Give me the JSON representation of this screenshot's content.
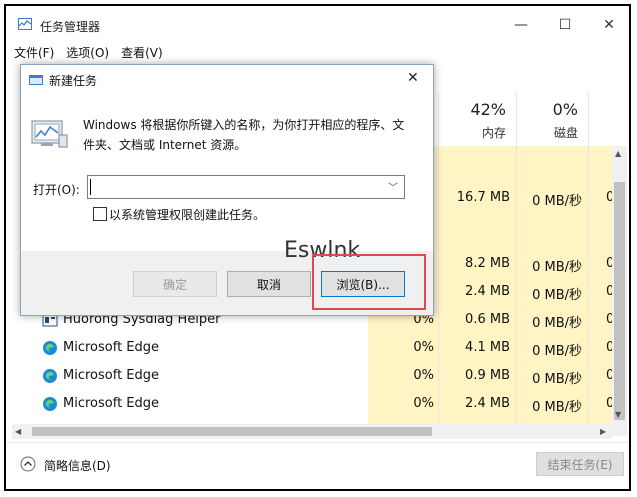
{
  "window": {
    "title": "任务管理器"
  },
  "menu": [
    "文件(F)",
    "选项(O)",
    "查看(V)"
  ],
  "columns": {
    "memory": {
      "percent": "42%",
      "label": "内存"
    },
    "disk": {
      "percent": "0%",
      "label": "磁盘"
    }
  },
  "rows": [
    {
      "name": "",
      "cpu": "",
      "mem": "16.7 MB",
      "disk": "0 MB/秒",
      "net": "0"
    },
    {
      "name": "",
      "cpu": "",
      "mem": "8.2 MB",
      "disk": "0 MB/秒",
      "net": "0"
    },
    {
      "name": "",
      "cpu": "",
      "mem": "2.4 MB",
      "disk": "0 MB/秒",
      "net": "0"
    },
    {
      "name": "Huorong Sysdiag Helper",
      "cpu": "0%",
      "mem": "0.6 MB",
      "disk": "0 MB/秒",
      "net": "0"
    },
    {
      "name": "Microsoft Edge",
      "cpu": "0%",
      "mem": "4.1 MB",
      "disk": "0 MB/秒",
      "net": "0"
    },
    {
      "name": "Microsoft Edge",
      "cpu": "0%",
      "mem": "0.9 MB",
      "disk": "0 MB/秒",
      "net": "0"
    },
    {
      "name": "Microsoft Edge",
      "cpu": "0%",
      "mem": "2.4 MB",
      "disk": "0 MB/秒",
      "net": "0"
    }
  ],
  "footer": {
    "fewer_details": "简略信息(D)",
    "end_task": "结束任务(E)"
  },
  "dialog": {
    "title": "新建任务",
    "description": "Windows 将根据你所键入的名称，为你打开相应的程序、文件夹、文档或 Internet 资源。",
    "open_label": "打开(O):",
    "open_value": "",
    "admin_label": "以系统管理权限创建此任务。",
    "ok_label": "确定",
    "cancel_label": "取消",
    "browse_label": "浏览(B)..."
  },
  "watermark": "Eswlnk",
  "colors": {
    "highlight_box": "#e14848",
    "usage_bg": "#fff4c4"
  }
}
